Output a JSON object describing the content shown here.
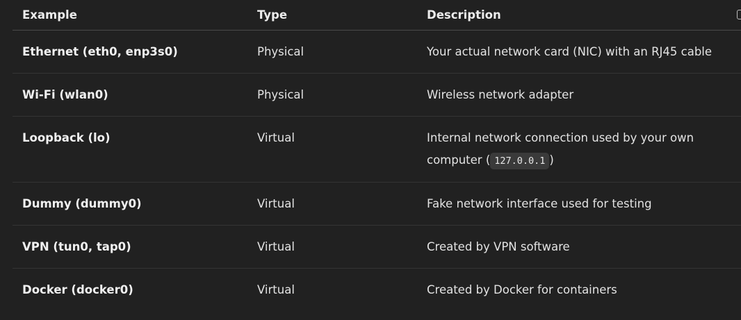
{
  "table": {
    "headers": [
      "Example",
      "Type",
      "Description"
    ],
    "rows": [
      {
        "example": "Ethernet (eth0, enp3s0)",
        "type": "Physical",
        "desc_before": "Your actual network card (NIC) with an RJ45 cable",
        "code": "",
        "desc_after": ""
      },
      {
        "example": "Wi-Fi (wlan0)",
        "type": "Physical",
        "desc_before": "Wireless network adapter",
        "code": "",
        "desc_after": ""
      },
      {
        "example": "Loopback (lo)",
        "type": "Virtual",
        "desc_before": "Internal network connection used by your own computer (",
        "code": "127.0.0.1",
        "desc_after": ")"
      },
      {
        "example": "Dummy (dummy0)",
        "type": "Virtual",
        "desc_before": "Fake network interface used for testing",
        "code": "",
        "desc_after": ""
      },
      {
        "example": "VPN (tun0, tap0)",
        "type": "Virtual",
        "desc_before": "Created by VPN software",
        "code": "",
        "desc_after": ""
      },
      {
        "example": "Docker (docker0)",
        "type": "Virtual",
        "desc_before": "Created by Docker for containers",
        "code": "",
        "desc_after": ""
      }
    ]
  },
  "icons": {
    "copy": "copy-icon"
  },
  "colors": {
    "background": "#212121",
    "text": "#ececec",
    "code_bg": "#3a3a3a",
    "divider": "#343434"
  }
}
